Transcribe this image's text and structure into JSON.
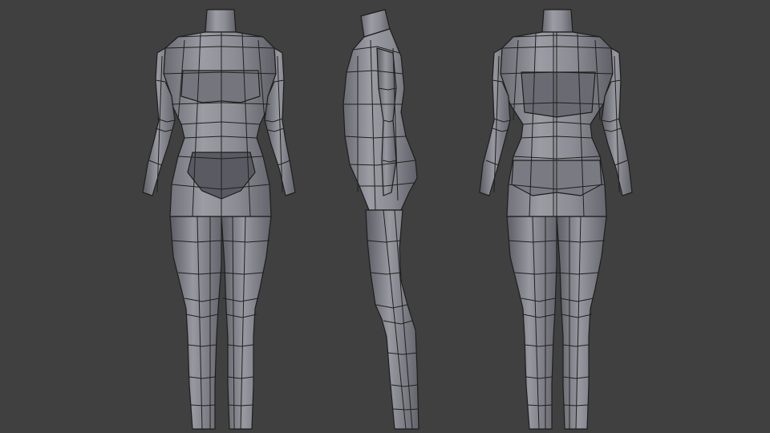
{
  "viewport": {
    "background": "#404040",
    "mesh_color_light": "#9a9aa2",
    "mesh_color_mid": "#7e7e86",
    "mesh_color_dark": "#5e5e66",
    "wire_color": "#202020"
  },
  "views": [
    {
      "name": "front"
    },
    {
      "name": "side"
    },
    {
      "name": "back"
    }
  ]
}
